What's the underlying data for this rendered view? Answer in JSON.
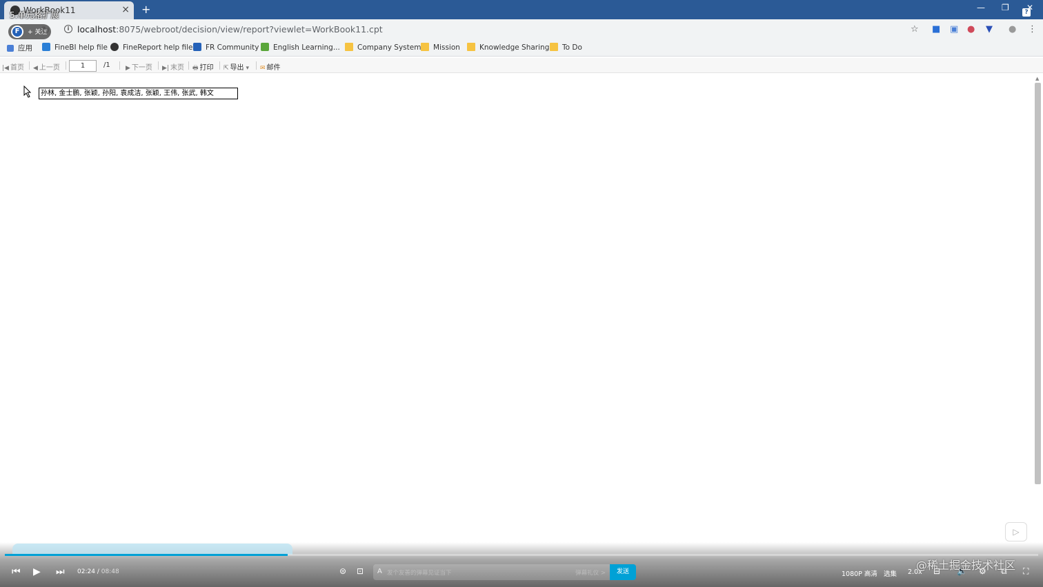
{
  "browser": {
    "tab_title": "WorkBook11",
    "video_title": "5.单元格扩展",
    "url_host": "localhost",
    "url_path": ":8075/webroot/decision/view/report?viewlet=WorkBook11.cpt"
  },
  "uploader": {
    "follow_label": "+ 关注",
    "avatar_letter": "F"
  },
  "bookmarks": {
    "apps": "应用",
    "items": [
      "FineBI help file",
      "FineReport help file",
      "FR Community",
      "English Learning...",
      "Company System",
      "Mission",
      "Knowledge Sharing",
      "To Do"
    ]
  },
  "report_toolbar": {
    "first": "首页",
    "prev": "上一页",
    "page_current": "1",
    "page_total": "/1",
    "next": "下一页",
    "last": "末页",
    "print": "打印",
    "export": "导出",
    "email": "邮件"
  },
  "report": {
    "cell_text": "孙林, 金士鹏, 张颖, 孙阳, 袁成洁, 张颖, 王伟, 张武, 韩文"
  },
  "player": {
    "time_current": "02:24",
    "time_sep": "/",
    "time_total": "08:48",
    "progress": 0.274,
    "danmaku_placeholder": "发个友善的弹幕见证当下",
    "danmaku_etiquette": "弹幕礼仪 >",
    "send": "发送",
    "quality": "1080P 高清",
    "episodes": "选集",
    "speed": "2.0x",
    "watermark": "@稀土掘金技术社区"
  }
}
